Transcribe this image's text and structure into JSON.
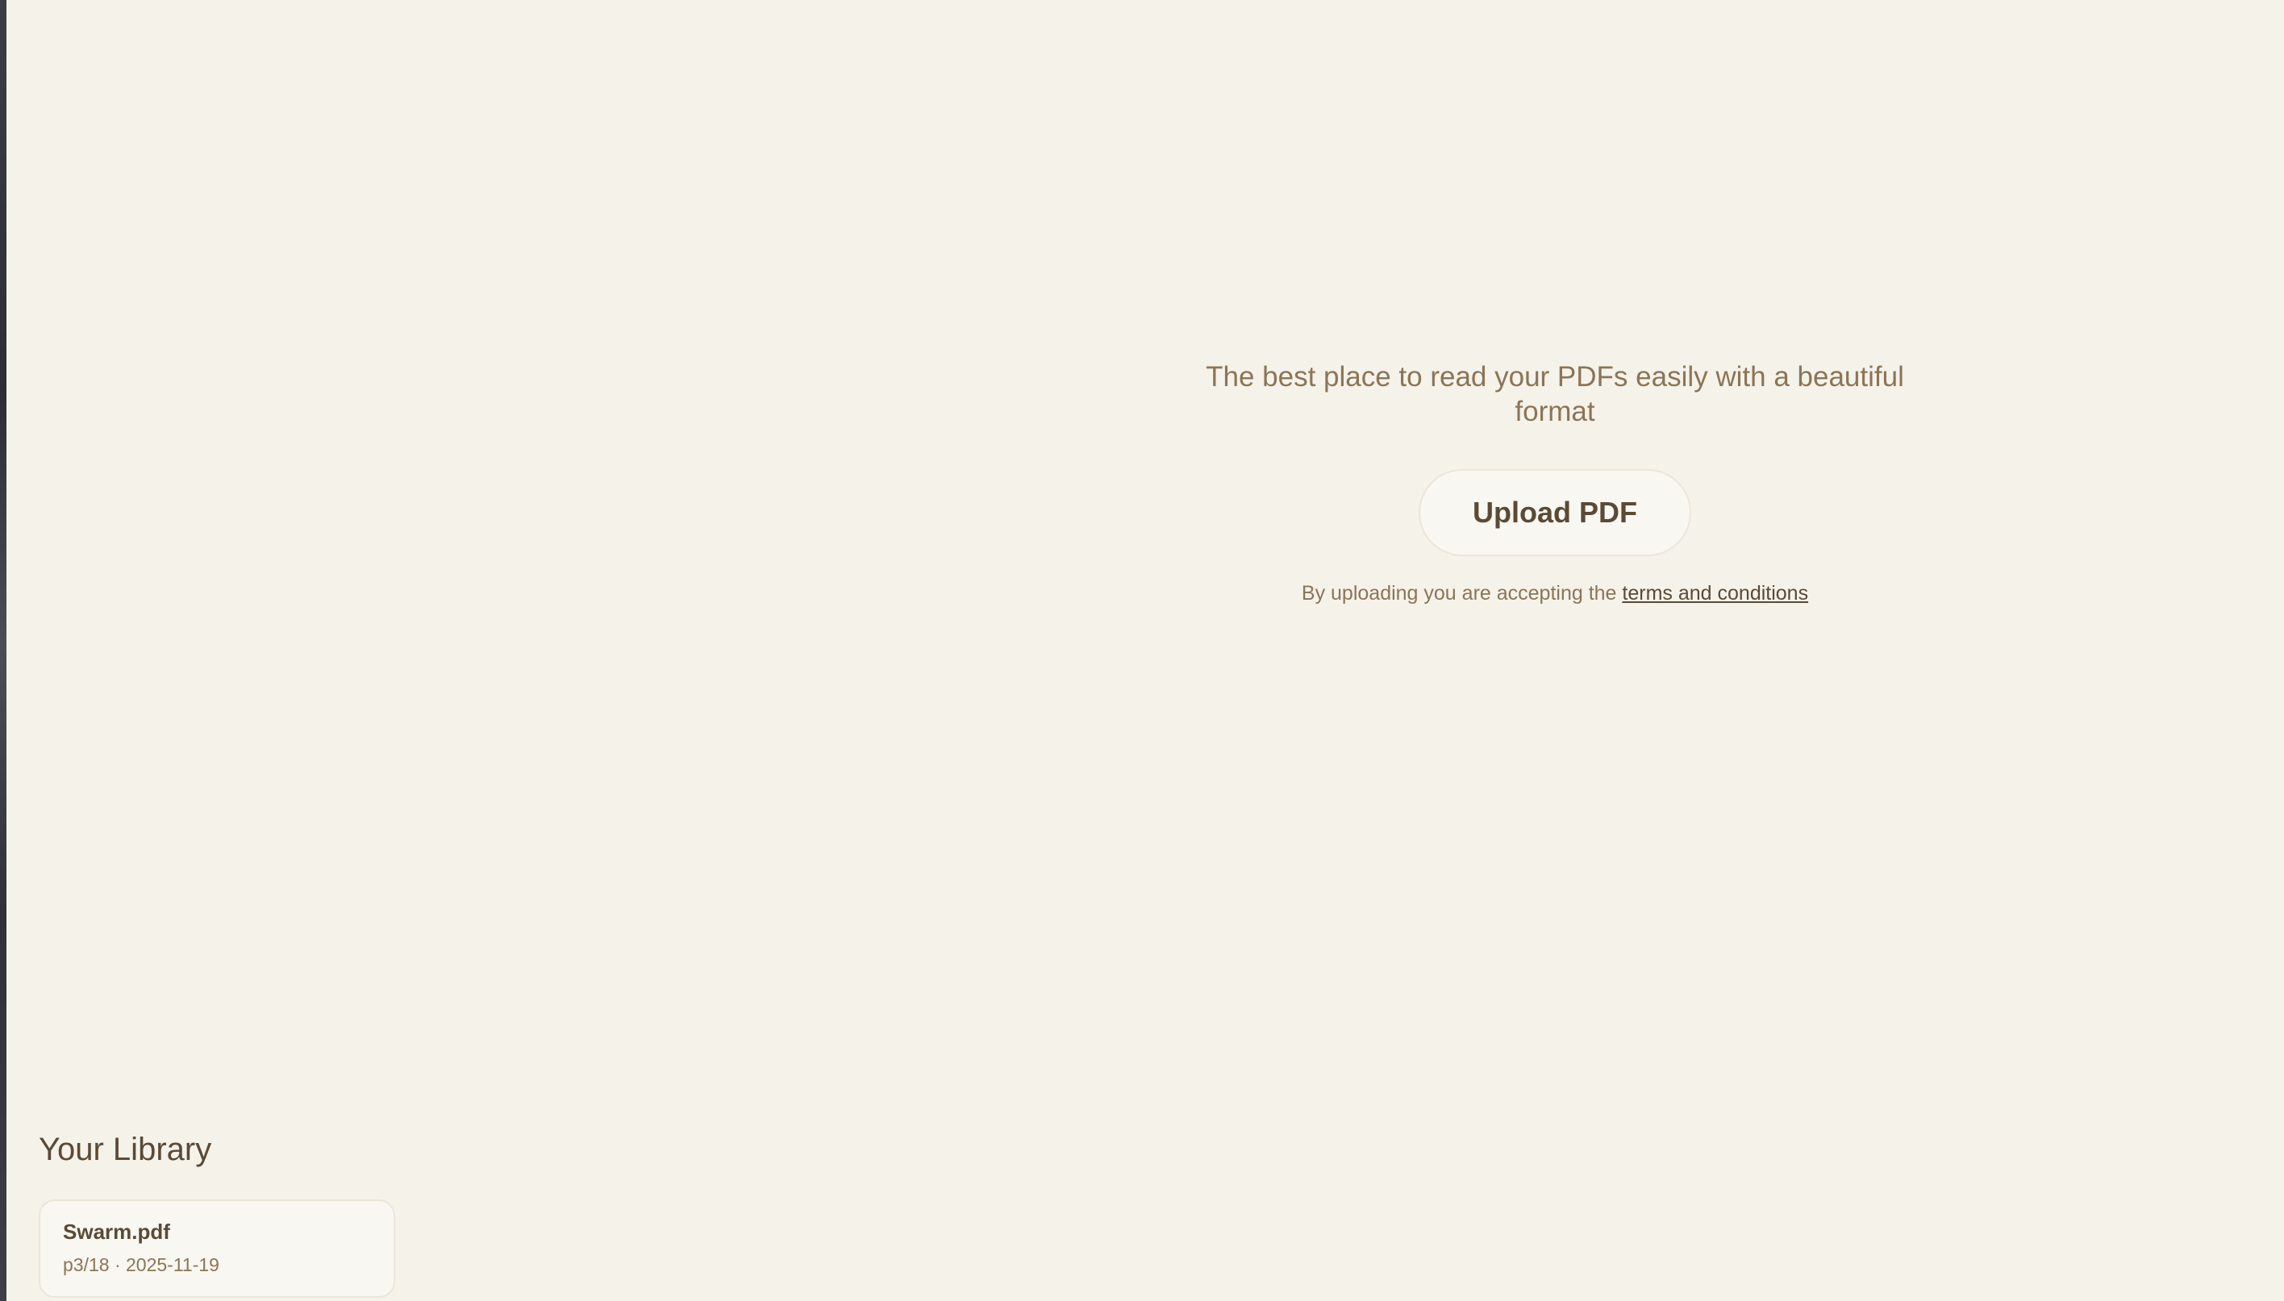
{
  "hero": {
    "tagline_line1": "The best place to read your PDFs easily with a beautiful",
    "tagline_line2": "format",
    "upload_label": "Upload PDF",
    "terms_prefix": "By uploading you are accepting the ",
    "terms_link": "terms and conditions"
  },
  "library": {
    "title": "Your Library",
    "items": [
      {
        "name": "Swarm.pdf",
        "page": "p3/18",
        "separator": " · ",
        "date": "2025-11-19"
      }
    ]
  },
  "colors": {
    "background": "#f5f2ea",
    "text_primary": "#5a4a36",
    "text_secondary": "#8a7556",
    "card_bg": "#f9f7f1",
    "border": "#ebe6da"
  }
}
